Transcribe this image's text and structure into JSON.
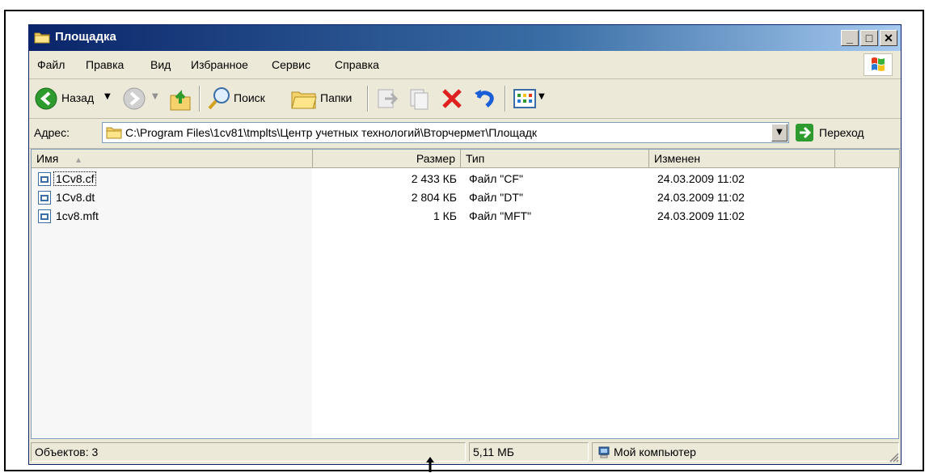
{
  "window": {
    "title": "Площадка"
  },
  "menu": {
    "items": [
      "Файл",
      "Правка",
      "Вид",
      "Избранное",
      "Сервис",
      "Справка"
    ]
  },
  "toolbar": {
    "back_label": "Назад",
    "search_label": "Поиск",
    "folders_label": "Папки"
  },
  "address": {
    "label": "Адрес:",
    "path": "C:\\Program Files\\1cv81\\tmplts\\Центр учетных технологий\\Вторчермет\\Площадк",
    "go_label": "Переход"
  },
  "list": {
    "columns": [
      "Имя",
      "Размер",
      "Тип",
      "Изменен"
    ],
    "rows": [
      {
        "name": "1Cv8.cf",
        "size": "2 433 КБ",
        "type": "Файл \"CF\"",
        "modified": "24.03.2009 11:02"
      },
      {
        "name": "1Cv8.dt",
        "size": "2 804 КБ",
        "type": "Файл \"DT\"",
        "modified": "24.03.2009 11:02"
      },
      {
        "name": "1cv8.mft",
        "size": "1 КБ",
        "type": "Файл \"MFT\"",
        "modified": "24.03.2009 11:02"
      }
    ]
  },
  "status": {
    "objects": "Объектов: 3",
    "size": "5,11 МБ",
    "location": "Мой компьютер"
  },
  "colors": {
    "title_start": "#0a246a",
    "title_end": "#a6caf0",
    "chrome": "#ece9d8",
    "delete_red": "#e02020"
  }
}
